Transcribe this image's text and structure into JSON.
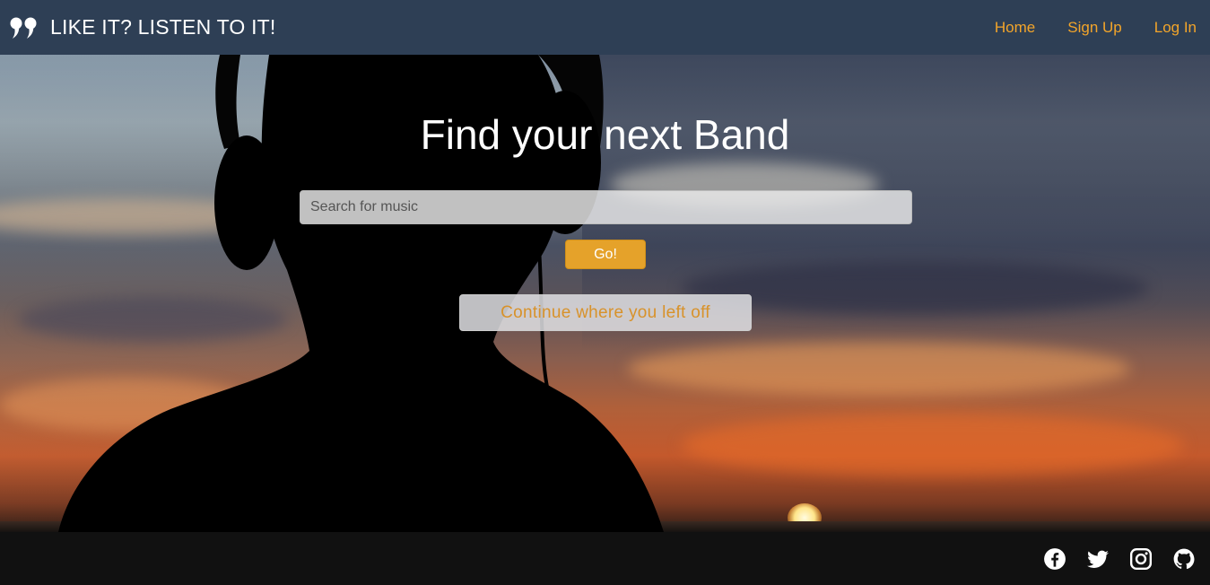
{
  "brand": {
    "icon": "quote-icon",
    "title": "LIKE IT? LISTEN TO IT!"
  },
  "nav": {
    "items": [
      {
        "label": "Home"
      },
      {
        "label": "Sign Up"
      },
      {
        "label": "Log In"
      }
    ]
  },
  "hero": {
    "title": "Find your next Band",
    "search": {
      "placeholder": "Search for music",
      "value": ""
    },
    "go_label": "Go!",
    "continue_label": "Continue where you left off"
  },
  "footer": {
    "social": [
      {
        "icon": "facebook-icon"
      },
      {
        "icon": "twitter-icon"
      },
      {
        "icon": "instagram-icon"
      },
      {
        "icon": "github-icon"
      }
    ]
  },
  "colors": {
    "navbar_bg": "#2e3f55",
    "accent": "#f3a52a",
    "button": "#e5a22a",
    "footer_bg": "#111111"
  }
}
